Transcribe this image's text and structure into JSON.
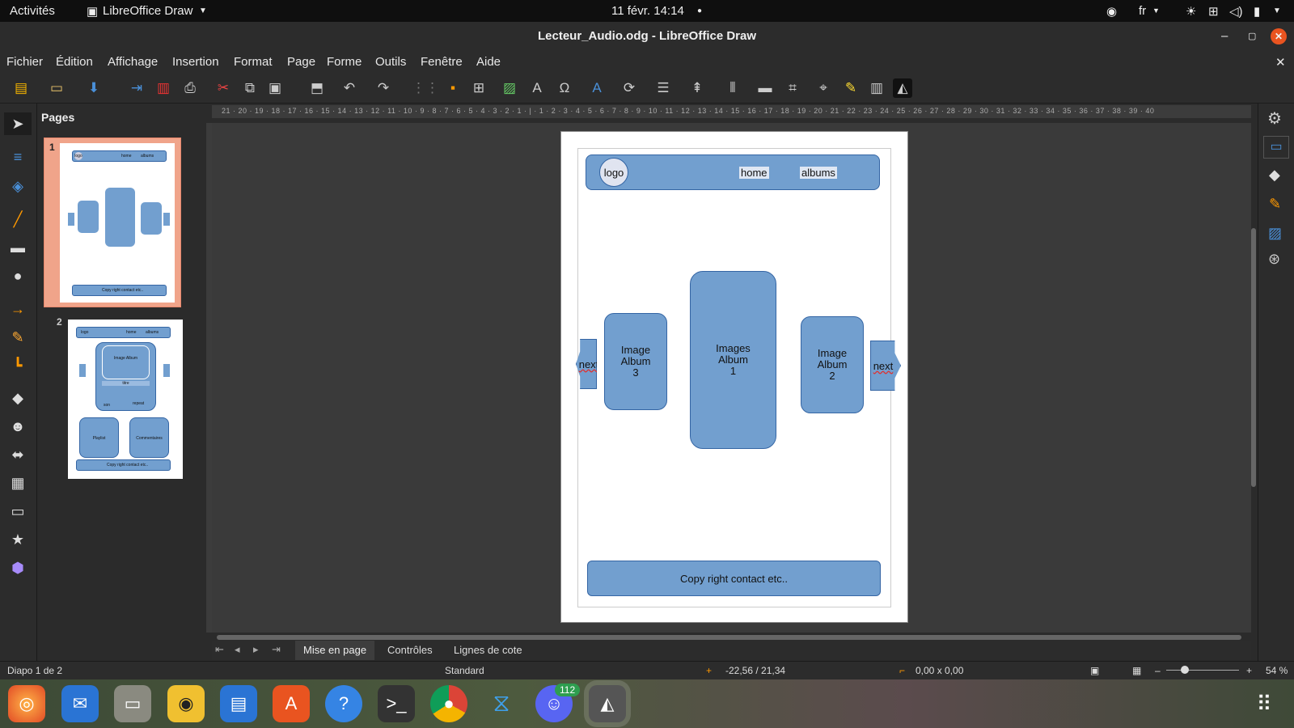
{
  "topbar": {
    "activities": "Activités",
    "app": "LibreOffice Draw",
    "clock": "11 févr.  14:14",
    "lang": "fr"
  },
  "window": {
    "title": "Lecteur_Audio.odg - LibreOffice Draw"
  },
  "menu": [
    "Fichier",
    "Édition",
    "Affichage",
    "Insertion",
    "Format",
    "Page",
    "Forme",
    "Outils",
    "Fenêtre",
    "Aide"
  ],
  "pages_panel": {
    "title": "Pages",
    "page1": "1",
    "page2": "2",
    "thumb1": {
      "logo": "logo",
      "home": "home",
      "albums": "albums",
      "img3": "Image Album 3",
      "img1": "Images Album 1",
      "img2": "Image Album 2",
      "footer": "Copy right contact etc.."
    },
    "thumb2": {
      "logo": "logo",
      "home": "home",
      "albums": "albums",
      "image": "Image Album",
      "title": "titre",
      "son": "son",
      "repeat": "repeat",
      "playlist": "Playlist",
      "comments": "Commentaires",
      "footer": "Copy right contact etc.."
    }
  },
  "ruler_h": "21 · 20 · 19 · 18 · 17 · 16 · 15 · 14 · 13 · 12 · 11 · 10 · 9 · 8 · 7 · 6 · 5 · 4 · 3 · 2 · 1 · | · 1 · 2 · 3 · 4 · 5 · 6 · 7 · 8 · 9 · 10 · 11 · 12 · 13 · 14 · 15 · 16 · 17 · 18 · 19 · 20 · 21 · 22 · 23 · 24 · 25 · 26 · 27 · 28 · 29 · 30 · 31 · 32 · 33 · 34 · 35 · 36 · 37 · 38 · 39 · 40",
  "drawing": {
    "logo": "logo",
    "home": "home",
    "albums": "albums",
    "prev": "next",
    "next": "next",
    "album3": "Image\nAlbum\n3",
    "album1": "Images\nAlbum\n1",
    "album2": "Image\nAlbum\n2",
    "footer": "Copy right contact etc.."
  },
  "tabs": [
    "Mise en page",
    "Contrôles",
    "Lignes de cote"
  ],
  "status": {
    "slide": "Diapo 1 de 2",
    "master": "Standard",
    "pos": "-22,56 / 21,34",
    "size": "0,00 x 0,00",
    "zoom": "54 %"
  },
  "dock": {
    "discord_badge": "112"
  }
}
